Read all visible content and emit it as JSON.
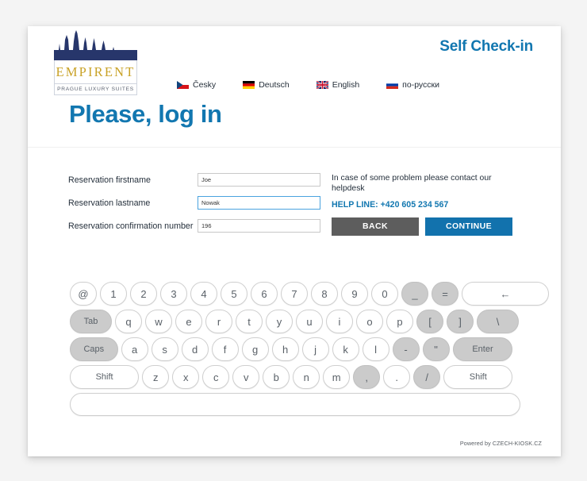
{
  "header": {
    "brand_name": "EMPIRENT",
    "brand_tagline": "PRAGUE LUXURY SUITES",
    "self_checkin": "Self Check-in",
    "brand_gold": "#c9a227",
    "brand_navy": "#27366b",
    "accent_blue": "#1277b0"
  },
  "languages": [
    {
      "label": "Česky",
      "flag": "cz-flag"
    },
    {
      "label": "Deutsch",
      "flag": "de-flag"
    },
    {
      "label": "English",
      "flag": "gb-flag"
    },
    {
      "label": "по-русски",
      "flag": "ru-flag"
    }
  ],
  "page_title": "Please, log in",
  "form": {
    "fields": [
      {
        "label": "Reservation firstname",
        "value": "Joe",
        "focused": false
      },
      {
        "label": "Reservation lastname",
        "value": "Nowak",
        "focused": true
      },
      {
        "label": "Reservation confirmation number",
        "value": "196",
        "focused": false
      }
    ]
  },
  "help": {
    "text": "In case of some problem please contact our helpdesk",
    "help_line": "HELP LINE: +420 605 234 567"
  },
  "buttons": {
    "back": "BACK",
    "continue": "CONTINUE",
    "back_color": "#5d5d5d",
    "continue_color": "#1272ad"
  },
  "keyboard": {
    "rows": [
      [
        {
          "label": "@",
          "gray": false
        },
        {
          "label": "1",
          "gray": false
        },
        {
          "label": "2",
          "gray": false
        },
        {
          "label": "3",
          "gray": false
        },
        {
          "label": "4",
          "gray": false
        },
        {
          "label": "5",
          "gray": false
        },
        {
          "label": "6",
          "gray": false
        },
        {
          "label": "7",
          "gray": false
        },
        {
          "label": "8",
          "gray": false
        },
        {
          "label": "9",
          "gray": false
        },
        {
          "label": "0",
          "gray": false
        },
        {
          "label": "_",
          "gray": true
        },
        {
          "label": "=",
          "gray": true
        },
        {
          "label": "←",
          "gray": false,
          "wide": 3
        }
      ],
      [
        {
          "label": "Tab",
          "gray": true,
          "wide": 1.5,
          "small": true
        },
        {
          "label": "q",
          "gray": false
        },
        {
          "label": "w",
          "gray": false
        },
        {
          "label": "e",
          "gray": false
        },
        {
          "label": "r",
          "gray": false
        },
        {
          "label": "t",
          "gray": false
        },
        {
          "label": "y",
          "gray": false
        },
        {
          "label": "u",
          "gray": false
        },
        {
          "label": "i",
          "gray": false
        },
        {
          "label": "o",
          "gray": false
        },
        {
          "label": "p",
          "gray": false
        },
        {
          "label": "[",
          "gray": true
        },
        {
          "label": "]",
          "gray": true
        },
        {
          "label": "\\",
          "gray": true,
          "wide": 1.5
        }
      ],
      [
        {
          "label": "Caps",
          "gray": true,
          "wide": 1.7,
          "small": true
        },
        {
          "label": "a",
          "gray": false
        },
        {
          "label": "s",
          "gray": false
        },
        {
          "label": "d",
          "gray": false
        },
        {
          "label": "f",
          "gray": false
        },
        {
          "label": "g",
          "gray": false
        },
        {
          "label": "h",
          "gray": false
        },
        {
          "label": "j",
          "gray": false
        },
        {
          "label": "k",
          "gray": false
        },
        {
          "label": "l",
          "gray": false
        },
        {
          "label": "-",
          "gray": true
        },
        {
          "label": "\"",
          "gray": true
        },
        {
          "label": "Enter",
          "gray": true,
          "wide": 2.1,
          "small": true
        }
      ],
      [
        {
          "label": "Shift",
          "gray": false,
          "wide": 2.4,
          "small": true
        },
        {
          "label": "z",
          "gray": false
        },
        {
          "label": "x",
          "gray": false
        },
        {
          "label": "c",
          "gray": false
        },
        {
          "label": "v",
          "gray": false
        },
        {
          "label": "b",
          "gray": false
        },
        {
          "label": "n",
          "gray": false
        },
        {
          "label": "m",
          "gray": false
        },
        {
          "label": ",",
          "gray": true
        },
        {
          "label": ".",
          "gray": false
        },
        {
          "label": "/",
          "gray": true
        },
        {
          "label": "Shift",
          "gray": false,
          "wide": 2.4,
          "small": true
        }
      ],
      [
        {
          "label": "",
          "gray": false,
          "space": true
        }
      ]
    ]
  },
  "footer": {
    "powered_by": "Powered by CZECH-KIOSK.CZ"
  }
}
